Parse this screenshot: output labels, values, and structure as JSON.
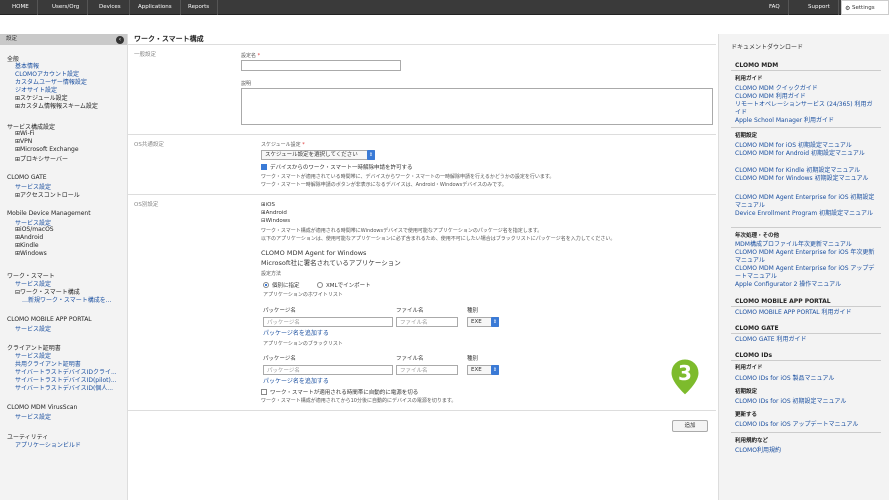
{
  "topbar": {
    "home": "HOME",
    "users": "Users/Org",
    "devices": "Devices",
    "applications": "Applications",
    "reports": "Reports",
    "faq": "FAQ",
    "support": "Support",
    "settings": "Settings"
  },
  "sidebar": {
    "header": "設定",
    "sections": [
      {
        "title": "全般",
        "items": [
          "基本情報",
          "CLOMOアカウント設定",
          "カスタムユーザー情報設定",
          "ジオサイト設定",
          "⊞スケジュール設定",
          "⊞カスタム情報報スキーム設定"
        ]
      },
      {
        "title": "サービス構成設定",
        "items": [
          "⊞Wi-Fi",
          "⊞VPN",
          "⊞Microsoft Exchange",
          "⊞プロキシサーバー"
        ]
      },
      {
        "title": "CLOMO GATE",
        "items": [
          "サービス設定",
          "⊞アクセスコントロール"
        ]
      },
      {
        "title": "Mobile Device Management",
        "items": [
          "サービス設定",
          "⊞iOS/macOS",
          "⊞Android",
          "⊞Kindle",
          "⊞Windows"
        ]
      },
      {
        "title": "ワーク・スマート",
        "items": [
          "サービス設定",
          "⊟ワーク・スマート構成",
          "…新規ワーク・スマート構成を..."
        ]
      },
      {
        "title": "CLOMO MOBILE APP PORTAL",
        "items": [
          "サービス設定"
        ]
      },
      {
        "title": "クライアント証明書",
        "items": [
          "サービス設定",
          "共用クライアント証明書",
          "サイバートラストデバイスIDクライ...",
          "サイバートラストデバイスID(pilot)...",
          "サイバートラストデバイスID(個人..."
        ]
      },
      {
        "title": "CLOMO MDM VirusScan",
        "items": [
          "サービス設定"
        ]
      },
      {
        "title": "ユーティリティ",
        "items": [
          "アプリケーションビルド"
        ]
      }
    ]
  },
  "main": {
    "title": "ワーク・スマート構成",
    "general": {
      "label": "一般設定",
      "name_label": "設定名",
      "required_mark": "*",
      "desc_label": "説明"
    },
    "os_common": {
      "label": "OS共通設定",
      "schedule_label": "スケジュール設定",
      "schedule_value": "スケジュール設定を選択してください",
      "allow_checkbox": "デバイスからのワーク・スマート一時解除申請を許可する",
      "allow_note1": "ワーク・スマートが適用されている時間帯に、デバイスからワーク・スマートの一時解除申請を行えるかどうかの設定を行います。",
      "allow_note2": "ワーク・スマート一時解除申請のボタンが非表示になるデバイスは、Android・Windowsデバイスのみです。"
    },
    "os_specific": {
      "label": "OS別設定",
      "tree": [
        "⊞iOS",
        "⊞Android",
        "⊟Windows"
      ],
      "note1": "ワーク・スマート構成が適用される時間帯にWindowsデバイスで使用可能なアプリケーションのパッケージ名を指定します。",
      "note2": "以下のアプリケーションは、使用可能なアプリケーションに必ず含まれるため、使用不可にしたい場合はブラックリストにパッケージ名を入力してください。",
      "agent1": "CLOMO MDM Agent for Windows",
      "agent2": "Microsoft社に署名されているアプリケーション",
      "method_label": "設定方法",
      "radio_individual": "個別に指定",
      "radio_xml": "XMLでインポート",
      "whitelist_label": "アプリケーションのホワイトリスト",
      "blacklist_label": "アプリケーションのブラックリスト",
      "col_package": "パッケージ名",
      "col_file": "ファイル名",
      "col_type": "種別",
      "ph_package": "パッケージ名",
      "ph_file": "ファイル名",
      "type_value": "EXE",
      "add_package": "パッケージ名を追加する",
      "power_checkbox": "ワーク・スマートが適用される時間帯に自動的に電源を切る",
      "power_note": "ワーク・スマート構成が適用されてから10分後に自動的にデバイスの電源を切ります。"
    },
    "add_button": "追加",
    "badge_number": "3",
    "badge_color": "#7dbb2c"
  },
  "right": {
    "title": "ドキュメントダウンロード",
    "clomo_mdm": "CLOMO MDM",
    "usage_guide": "利用ガイド",
    "links1": [
      "CLOMO MDM クイックガイド",
      "CLOMO MDM 利用ガイド",
      "リモートオペレーションサービス (24/365) 利用ガイド",
      "Apple School Manager 利用ガイド"
    ],
    "initial_setup": "初期設定",
    "links2": [
      "CLOMO MDM for iOS 初期設定マニュアル",
      "CLOMO MDM for Android 初期設定マニュアル",
      "CLOMO MDM for Kindle 初期設定マニュアル",
      "CLOMO MDM for Windows 初期設定マニュアル",
      "CLOMO MDM Agent Enterprise for iOS 初期設定マニュアル",
      "Device Enrollment Program 初期設定マニュアル"
    ],
    "annual": "年次処理・その他",
    "links3": [
      "MDM構成プロファイル年次更新マニュアル",
      "CLOMO MDM Agent Enterprise for iOS 年次更新マニュアル",
      "CLOMO MDM Agent Enterprise for iOS アップデートマニュアル",
      "Apple Configurator 2 操作マニュアル"
    ],
    "portal": "CLOMO MOBILE APP PORTAL",
    "portal_link": "CLOMO MOBILE APP PORTAL 利用ガイド",
    "gate": "CLOMO GATE",
    "gate_link": "CLOMO GATE 利用ガイド",
    "ids": "CLOMO IDs",
    "ids_usage": "利用ガイド",
    "ids_link1": "CLOMO IDs for iOS 製品マニュアル",
    "ids_init": "初期設定",
    "ids_link2": "CLOMO IDs for iOS 初期設定マニュアル",
    "ids_update": "更新する",
    "ids_link3": "CLOMO IDs for iOS アップデートマニュアル",
    "terms": "利用規約など",
    "terms_link": "CLOMO利用規約"
  }
}
